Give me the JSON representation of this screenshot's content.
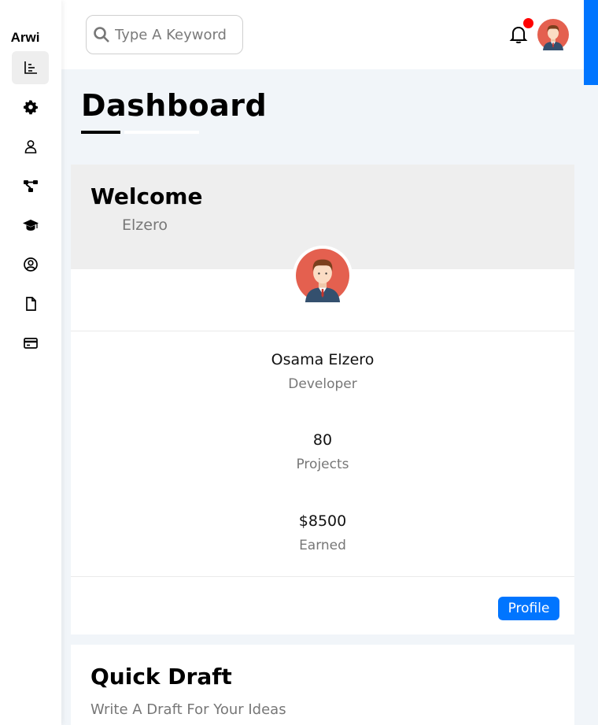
{
  "brand": "Arwi",
  "sidebar": {
    "items": [
      {
        "icon": "chart-icon",
        "active": true
      },
      {
        "icon": "gear-icon",
        "active": false
      },
      {
        "icon": "user-icon",
        "active": false
      },
      {
        "icon": "diagram-icon",
        "active": false
      },
      {
        "icon": "graduation-cap-icon",
        "active": false
      },
      {
        "icon": "user-circle-icon",
        "active": false
      },
      {
        "icon": "file-icon",
        "active": false
      },
      {
        "icon": "credit-card-icon",
        "active": false
      }
    ]
  },
  "header": {
    "search_placeholder": "Type A Keyword",
    "has_notification": true
  },
  "page": {
    "title": "Dashboard"
  },
  "welcome": {
    "heading": "Welcome",
    "name": "Elzero",
    "user_name": "Osama Elzero",
    "user_role": "Developer",
    "projects_value": "80",
    "projects_label": "Projects",
    "earned_value": "$8500",
    "earned_label": "Earned",
    "profile_button": "Profile"
  },
  "draft": {
    "title": "Quick Draft",
    "subtitle": "Write A Draft For Your Ideas"
  },
  "colors": {
    "accent": "#0075ff",
    "notification": "#ff0000",
    "background": "#f1f5f9"
  }
}
